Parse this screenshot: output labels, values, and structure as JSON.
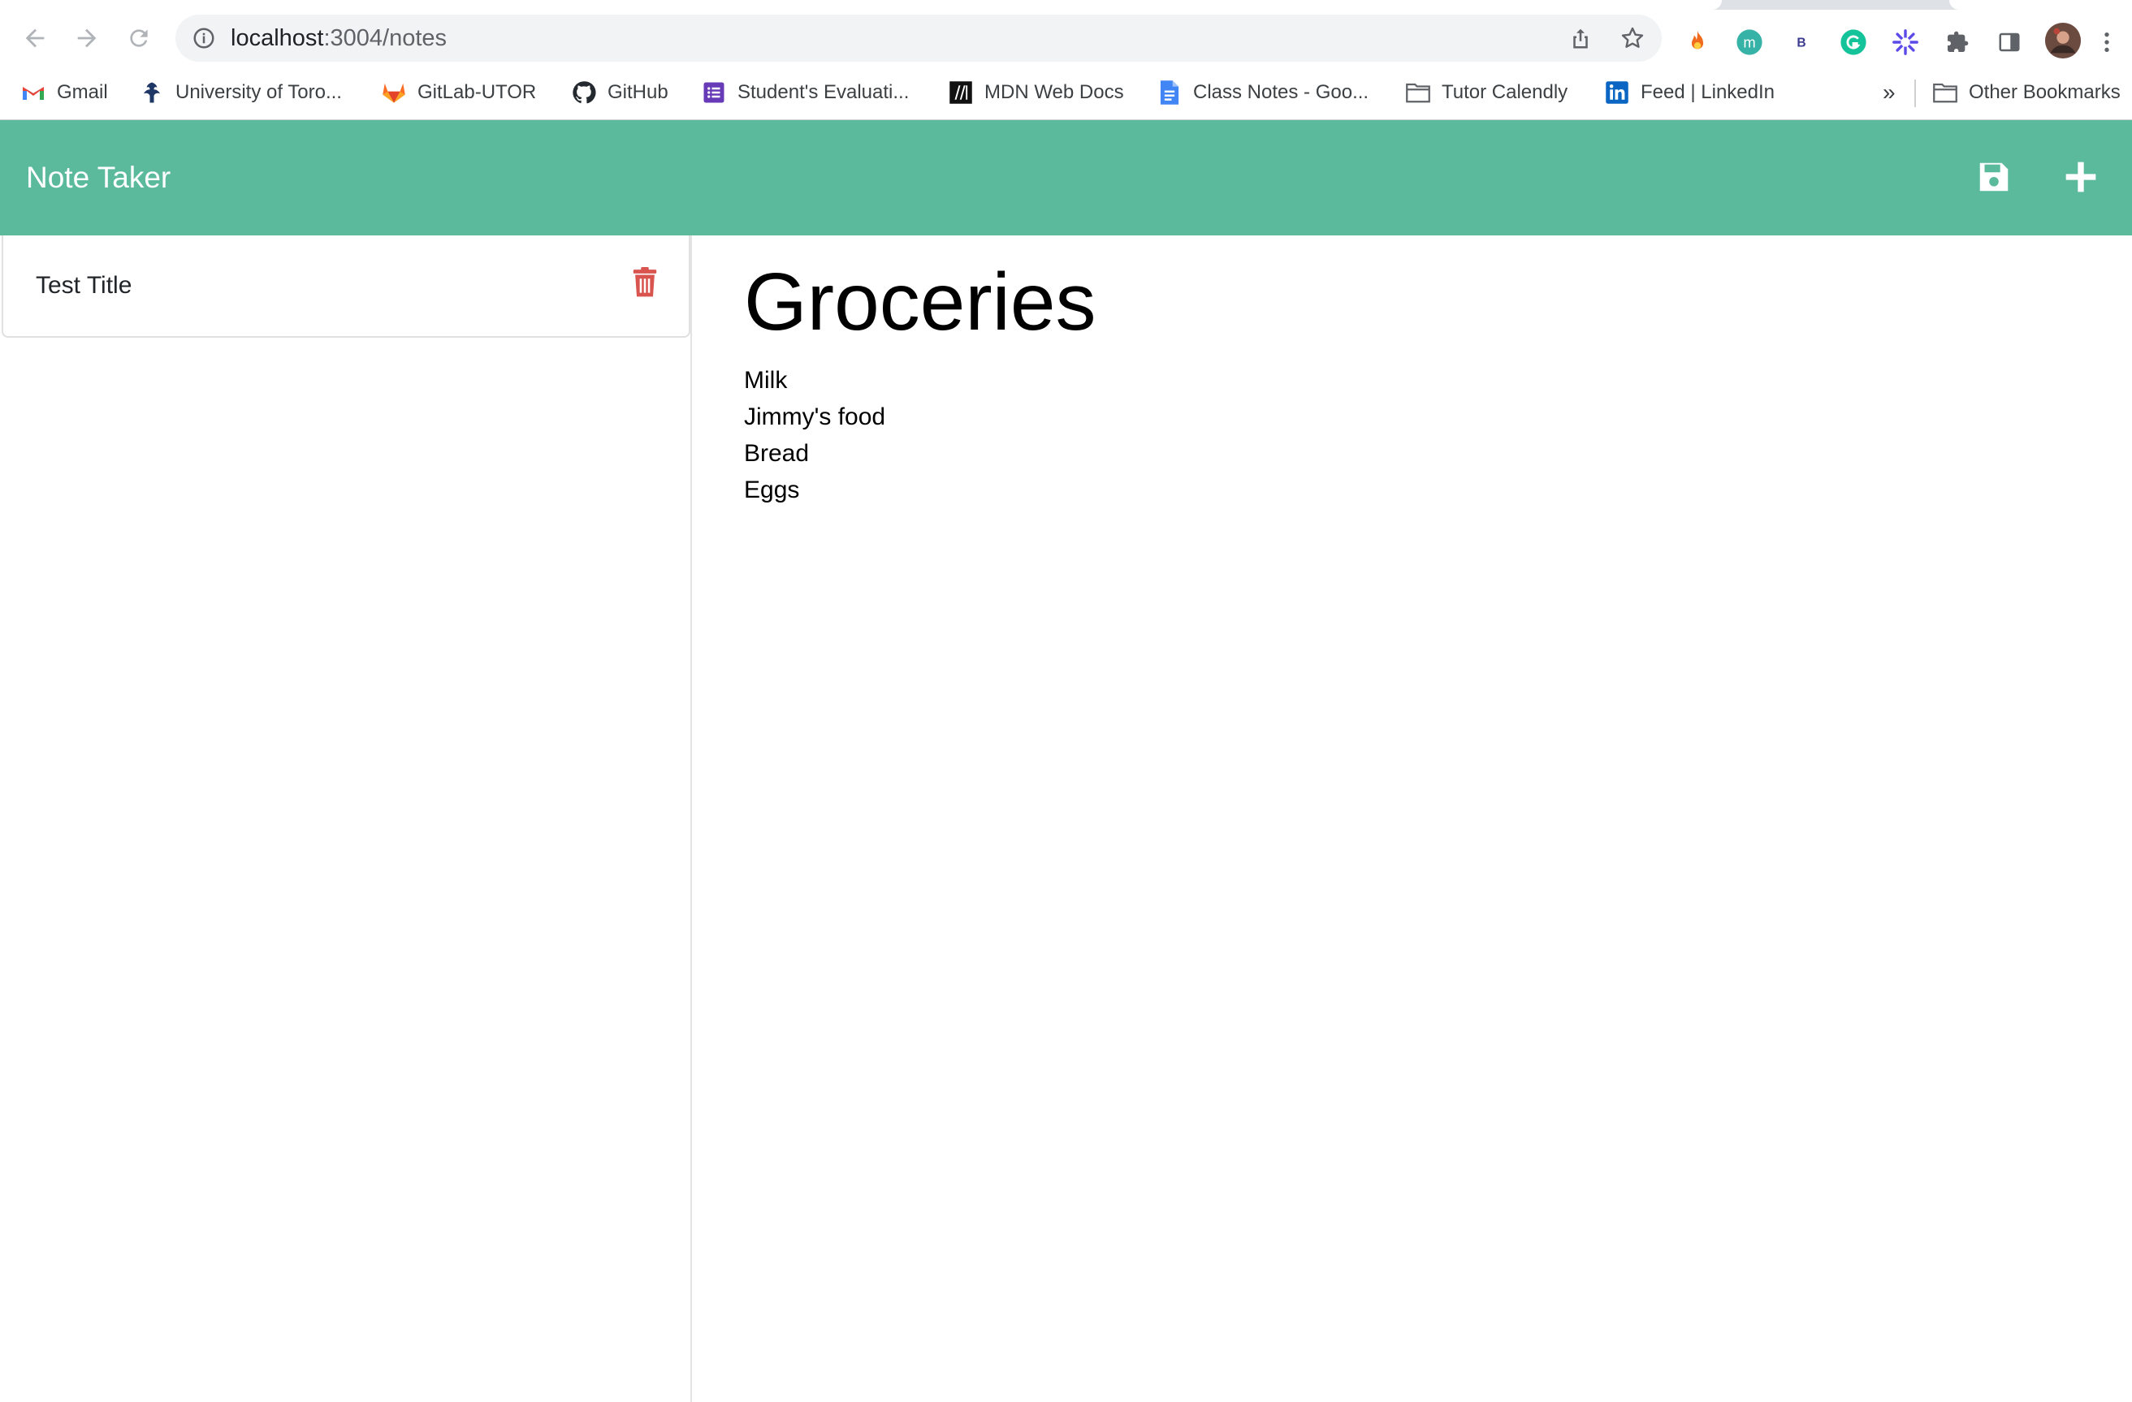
{
  "browser": {
    "url_host": "localhost",
    "url_path": ":3004/notes",
    "bookmarks": [
      {
        "label": "Gmail",
        "icon": "gmail-icon"
      },
      {
        "label": "University of Toro...",
        "icon": "uoft-icon"
      },
      {
        "label": "GitLab-UTOR",
        "icon": "gitlab-icon"
      },
      {
        "label": "GitHub",
        "icon": "github-icon"
      },
      {
        "label": "Student's Evaluati...",
        "icon": "forms-icon"
      },
      {
        "label": "MDN Web Docs",
        "icon": "mdn-icon"
      },
      {
        "label": "Class Notes - Goo...",
        "icon": "google-docs-icon"
      },
      {
        "label": "Tutor Calendly",
        "icon": "folder-icon"
      },
      {
        "label": "Feed | LinkedIn",
        "icon": "linkedin-icon"
      }
    ],
    "overflow_label": "»",
    "other_bookmarks": "Other Bookmarks",
    "extensions": [
      "fire-extension-icon",
      "m-extension-icon",
      "b-extension-icon",
      "grammarly-icon",
      "burst-extension-icon",
      "puzzle-icon",
      "side-panel-icon",
      "profile-avatar"
    ]
  },
  "app": {
    "brand": "Note Taker",
    "accent_color": "#5bba9c",
    "delete_color": "#d9534f",
    "nav_icons": [
      "save-icon",
      "plus-icon"
    ]
  },
  "notes_list": [
    {
      "title": "Test Title"
    }
  ],
  "active_note": {
    "title": "Groceries",
    "lines": [
      "Milk",
      "Jimmy's food",
      "Bread",
      "Eggs"
    ]
  }
}
